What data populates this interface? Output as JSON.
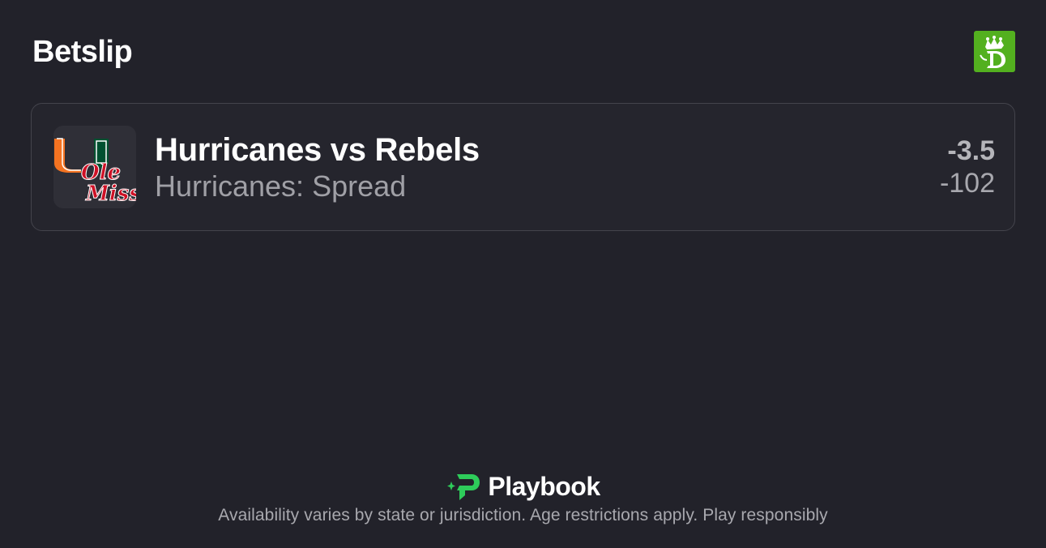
{
  "header": {
    "title": "Betslip",
    "brand_icon": "draftkings-crown-logo-icon",
    "brand_color": "#53b01f"
  },
  "bet": {
    "matchup": "Hurricanes vs Rebels",
    "market": "Hurricanes: Spread",
    "line": "-3.5",
    "odds": "-102",
    "logo_icon": "hurricanes-ole-miss-team-logo",
    "logo_text": "Ole Miss",
    "colors": {
      "hurricanes_orange": "#f47321",
      "hurricanes_green": "#005030",
      "rebels_red": "#ce1126"
    }
  },
  "footer": {
    "brand_name": "Playbook",
    "brand_icon": "playbook-logo-icon",
    "brand_color": "#2ecc5a",
    "disclaimer": "Availability varies by state or jurisdiction. Age restrictions apply. Play responsibly"
  }
}
